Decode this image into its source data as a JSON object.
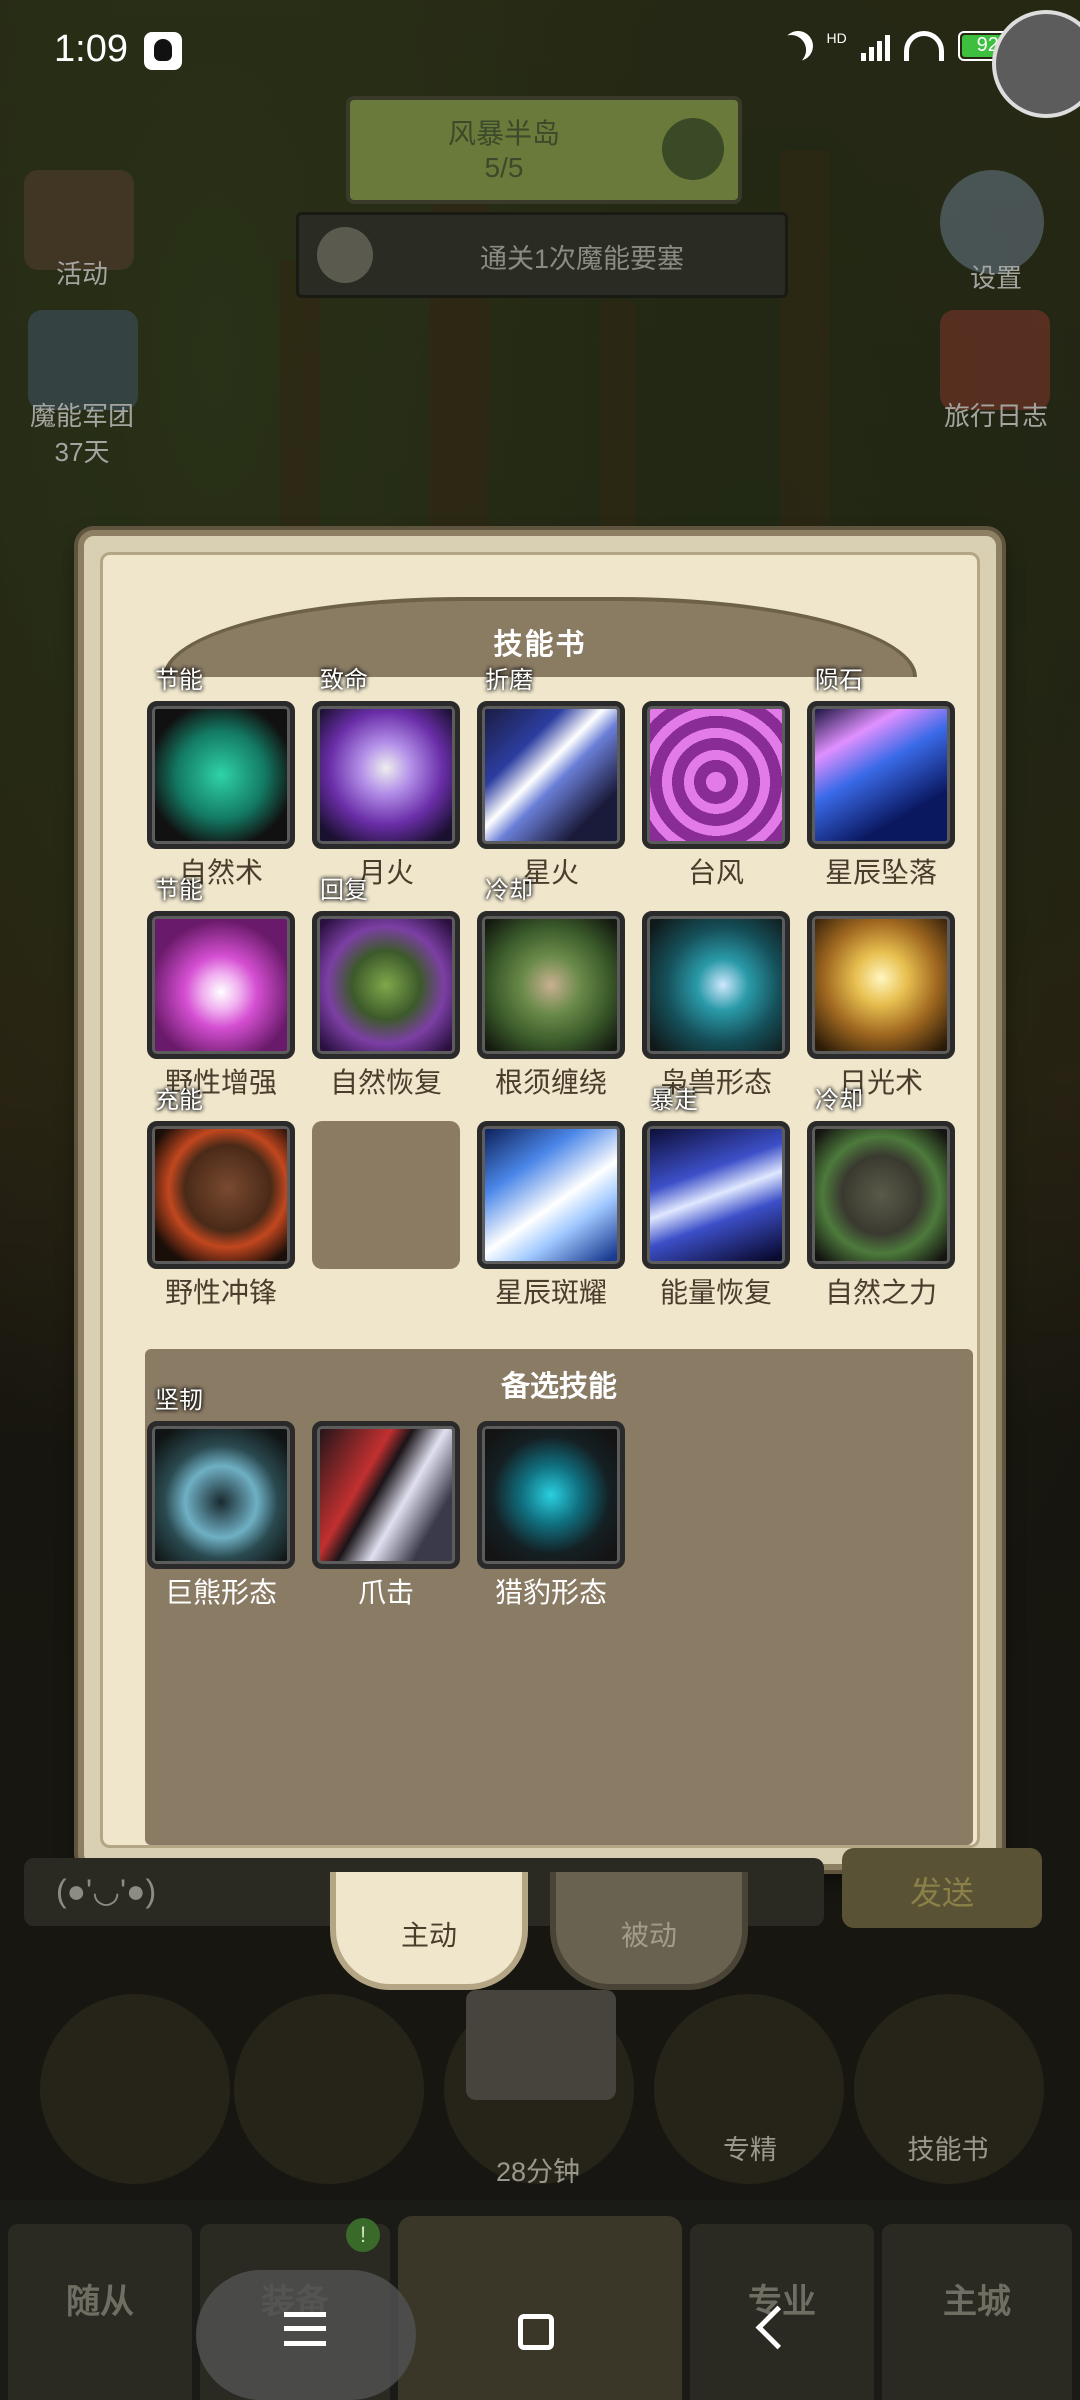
{
  "status_bar": {
    "time": "1:09",
    "hd_label": "HD",
    "battery": "92",
    "battery_level": 0.92,
    "icons": [
      "qq-icon",
      "moon-icon",
      "signal-icon",
      "wifi-icon",
      "battery-icon",
      "charging-icon"
    ]
  },
  "hud": {
    "map_name": "风暴半岛",
    "map_progress": "5/5",
    "quest": "通关1次魔能要塞",
    "left_buttons": [
      {
        "label": "活动"
      },
      {
        "label": "魔能军团"
      },
      {
        "label": "37天"
      }
    ],
    "right_buttons": [
      {
        "label": "设置"
      },
      {
        "label": "旅行日志"
      }
    ]
  },
  "dialog": {
    "title": "技能书",
    "skills": [
      {
        "name": "自然术",
        "tag": "节能",
        "color": "#2fd3a7"
      },
      {
        "name": "月火",
        "tag": "致命",
        "color": "#9b4fd6"
      },
      {
        "name": "星火",
        "tag": "折磨",
        "color": "#6b7fd8"
      },
      {
        "name": "台风",
        "tag": "",
        "color": "#b84bc4"
      },
      {
        "name": "星辰坠落",
        "tag": "陨石",
        "color": "#2a56c8"
      },
      {
        "name": "野性增强",
        "tag": "节能",
        "color": "#d54fd2"
      },
      {
        "name": "自然恢复",
        "tag": "回复",
        "color": "#7c3fa4"
      },
      {
        "name": "根须缠绕",
        "tag": "冷却",
        "color": "#4f7a3a"
      },
      {
        "name": "枭兽形态",
        "tag": "",
        "color": "#2a9aa8"
      },
      {
        "name": "日光术",
        "tag": "",
        "color": "#d9a435"
      },
      {
        "name": "野性冲锋",
        "tag": "充能",
        "color": "#c2471f"
      },
      {
        "name": "星辰斑耀",
        "tag": "",
        "color": "#4a86e8"
      },
      {
        "name": "能量恢复",
        "tag": "暴走",
        "color": "#3c4fc8"
      },
      {
        "name": "自然之力",
        "tag": "冷却",
        "color": "#4d5d3c"
      }
    ],
    "alt_title": "备选技能",
    "alt_skills": [
      {
        "name": "巨熊形态",
        "tag": "坚韧",
        "color": "#6fb0c4"
      },
      {
        "name": "爪击",
        "tag": "",
        "color": "#c23030"
      },
      {
        "name": "猎豹形态",
        "tag": "",
        "color": "#2ad0e0"
      }
    ]
  },
  "bottom": {
    "chat_placeholder": "(●'◡'●)",
    "send_label": "发送",
    "tabs": [
      {
        "label": "主动"
      },
      {
        "label": "被动"
      }
    ],
    "chest_timer": "28分钟",
    "mastery_label": "专精",
    "skillbook_label": "技能书",
    "nav": [
      {
        "label": "随从"
      },
      {
        "label": "装备"
      },
      {
        "label": "专业"
      },
      {
        "label": "主城"
      }
    ],
    "nav_badge": "!"
  }
}
